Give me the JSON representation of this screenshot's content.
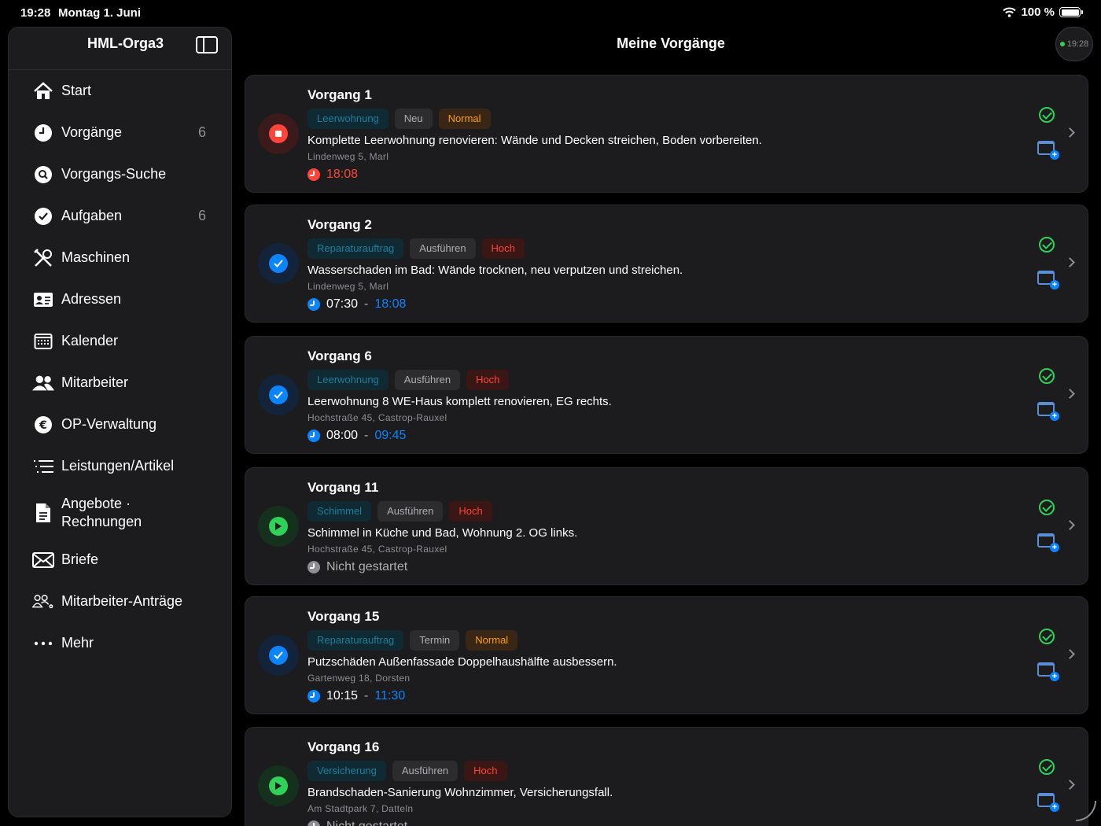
{
  "status_bar": {
    "time": "19:28",
    "date": "Montag 1. Juni",
    "battery": "100 %"
  },
  "sidebar": {
    "title": "HML-Orga3",
    "items": [
      {
        "label": "Start",
        "icon": "house-icon",
        "count": ""
      },
      {
        "label": "Vorgänge",
        "icon": "clock-icon",
        "count": "6"
      },
      {
        "label": "Vorgangs-Suche",
        "icon": "search-icon",
        "count": ""
      },
      {
        "label": "Aufgaben",
        "icon": "checkmark-icon",
        "count": "6"
      },
      {
        "label": "Maschinen",
        "icon": "tools-icon",
        "count": ""
      },
      {
        "label": "Adressen",
        "icon": "address-card-icon",
        "count": ""
      },
      {
        "label": "Kalender",
        "icon": "calendar-icon",
        "count": ""
      },
      {
        "label": "Mitarbeiter",
        "icon": "people-icon",
        "count": ""
      },
      {
        "label": "OP-Verwaltung",
        "icon": "euro-icon",
        "count": ""
      },
      {
        "label": "Leistungen/Artikel",
        "icon": "list-icon",
        "count": ""
      },
      {
        "label": "Angebote · Rechnungen",
        "icon": "document-icon",
        "count": ""
      },
      {
        "label": "Briefe",
        "icon": "envelope-icon",
        "count": ""
      },
      {
        "label": "Mitarbeiter-Anträge",
        "icon": "people-gear-icon",
        "count": ""
      },
      {
        "label": "Mehr",
        "icon": "ellipsis-icon",
        "count": ""
      }
    ]
  },
  "header": {
    "title": "Meine Vorgänge",
    "clock": "19:28"
  },
  "colors": {
    "red": "#ff453a",
    "blue": "#0a84ff",
    "green": "#30d158",
    "orange": "#ff9f0a"
  },
  "cards": [
    {
      "title": "Vorgang 1",
      "type": "Leerwohnung",
      "status": "Neu",
      "priority": "Normal",
      "prio_class": "normal",
      "desc": "Komplette Leerwohnung renovieren: Wände und Decken streichen, Boden vorbereiten.",
      "address": "Lindenweg 5, Marl",
      "state": "stopped",
      "time_start": "18:08",
      "sep": "",
      "time_end": ""
    },
    {
      "title": "Vorgang 2",
      "type": "Reparaturauftrag",
      "status": "Ausführen",
      "priority": "Hoch",
      "prio_class": "hoch",
      "desc": "Wasserschaden im Bad: Wände trocknen, neu verputzen und streichen.",
      "address": "Lindenweg 5, Marl",
      "state": "done",
      "time_start": "07:30",
      "sep": "-",
      "time_end": "18:08"
    },
    {
      "title": "Vorgang 6",
      "type": "Leerwohnung",
      "status": "Ausführen",
      "priority": "Hoch",
      "prio_class": "hoch",
      "desc": "Leerwohnung 8 WE-Haus komplett renovieren, EG rechts.",
      "address": "Hochstraße 45, Castrop-Rauxel",
      "state": "done",
      "time_start": "08:00",
      "sep": "-",
      "time_end": "09:45"
    },
    {
      "title": "Vorgang 11",
      "type": "Schimmel",
      "status": "Ausführen",
      "priority": "Hoch",
      "prio_class": "hoch",
      "desc": "Schimmel in Küche und Bad, Wohnung 2. OG links.",
      "address": "Hochstraße 45, Castrop-Rauxel",
      "state": "play",
      "time_start": "Nicht gestartet",
      "sep": "",
      "time_end": ""
    },
    {
      "title": "Vorgang 15",
      "type": "Reparaturauftrag",
      "status": "Termin",
      "priority": "Normal",
      "prio_class": "normal",
      "desc": "Putzschäden Außenfassade Doppelhaushälfte ausbessern.",
      "address": "Gartenweg 18, Dorsten",
      "state": "done",
      "time_start": "10:15",
      "sep": "-",
      "time_end": "11:30"
    },
    {
      "title": "Vorgang 16",
      "type": "Versicherung",
      "status": "Ausführen",
      "priority": "Hoch",
      "prio_class": "hoch",
      "desc": "Brandschaden-Sanierung Wohnzimmer, Versicherungsfall.",
      "address": "Am Stadtpark 7, Datteln",
      "state": "play",
      "time_start": "Nicht gestartet",
      "sep": "",
      "time_end": ""
    }
  ]
}
